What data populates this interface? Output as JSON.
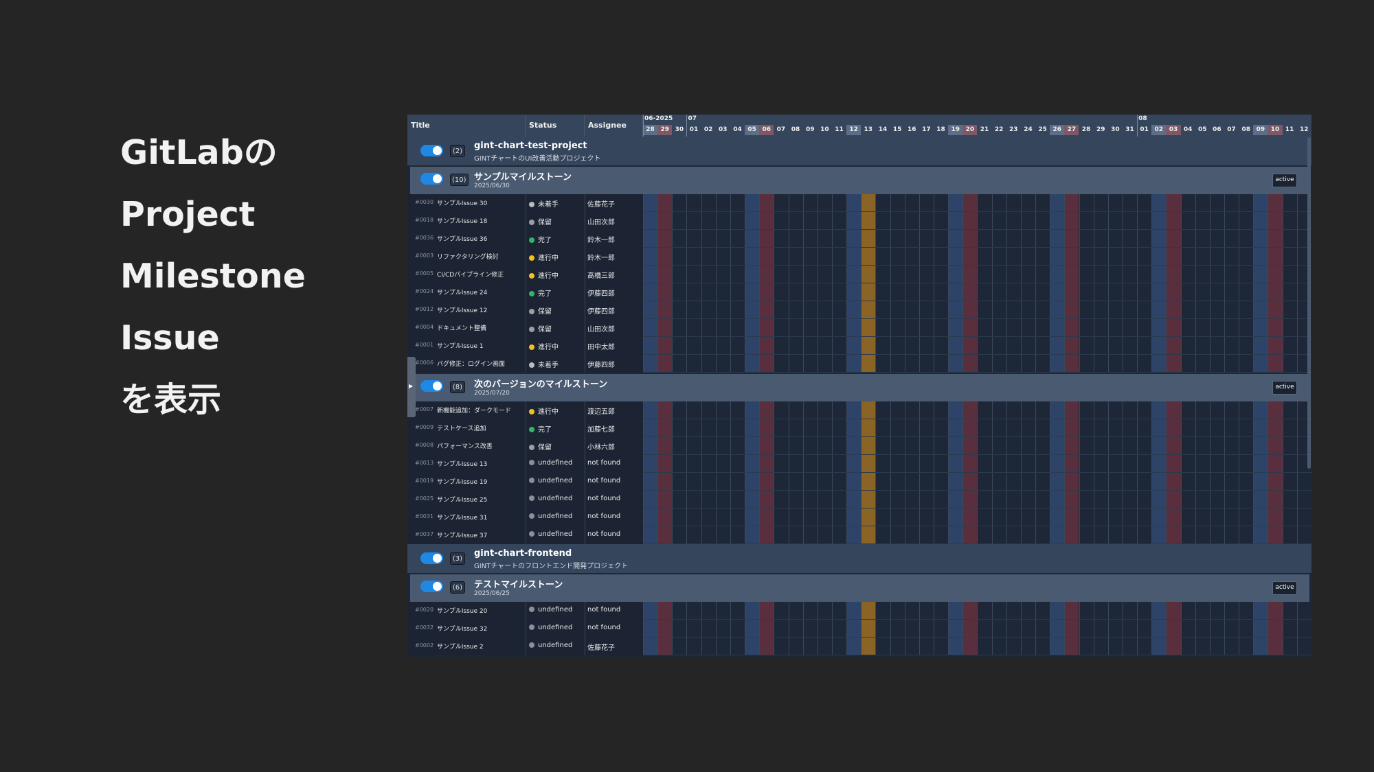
{
  "slide_lines": [
    "GitLabの",
    "Project",
    "Milestone",
    "Issue",
    "を表示"
  ],
  "columns": {
    "title": "Title",
    "status": "Status",
    "assignee": "Assignee"
  },
  "months": [
    {
      "label": "06-2025",
      "day_index": 0
    },
    {
      "label": "07",
      "day_index": 3
    },
    {
      "label": "08",
      "day_index": 34
    }
  ],
  "days": [
    {
      "d": "28",
      "w": "sat"
    },
    {
      "d": "29",
      "w": "sun"
    },
    {
      "d": "30",
      "w": ""
    },
    {
      "d": "01",
      "w": ""
    },
    {
      "d": "02",
      "w": ""
    },
    {
      "d": "03",
      "w": ""
    },
    {
      "d": "04",
      "w": ""
    },
    {
      "d": "05",
      "w": "sat"
    },
    {
      "d": "06",
      "w": "sun"
    },
    {
      "d": "07",
      "w": ""
    },
    {
      "d": "08",
      "w": ""
    },
    {
      "d": "09",
      "w": ""
    },
    {
      "d": "10",
      "w": ""
    },
    {
      "d": "11",
      "w": ""
    },
    {
      "d": "12",
      "w": "sat"
    },
    {
      "d": "13",
      "w": "today"
    },
    {
      "d": "14",
      "w": ""
    },
    {
      "d": "15",
      "w": ""
    },
    {
      "d": "16",
      "w": ""
    },
    {
      "d": "17",
      "w": ""
    },
    {
      "d": "18",
      "w": ""
    },
    {
      "d": "19",
      "w": "sat"
    },
    {
      "d": "20",
      "w": "sun"
    },
    {
      "d": "21",
      "w": ""
    },
    {
      "d": "22",
      "w": ""
    },
    {
      "d": "23",
      "w": ""
    },
    {
      "d": "24",
      "w": ""
    },
    {
      "d": "25",
      "w": ""
    },
    {
      "d": "26",
      "w": "sat"
    },
    {
      "d": "27",
      "w": "sun"
    },
    {
      "d": "28",
      "w": ""
    },
    {
      "d": "29",
      "w": ""
    },
    {
      "d": "30",
      "w": ""
    },
    {
      "d": "31",
      "w": ""
    },
    {
      "d": "01",
      "w": ""
    },
    {
      "d": "02",
      "w": "sat"
    },
    {
      "d": "03",
      "w": "sun"
    },
    {
      "d": "04",
      "w": ""
    },
    {
      "d": "05",
      "w": ""
    },
    {
      "d": "06",
      "w": ""
    },
    {
      "d": "07",
      "w": ""
    },
    {
      "d": "08",
      "w": ""
    },
    {
      "d": "09",
      "w": "sat"
    },
    {
      "d": "10",
      "w": "sun"
    },
    {
      "d": "11",
      "w": ""
    },
    {
      "d": "12",
      "w": ""
    }
  ],
  "status_colors": {
    "未着手": "#b8bcc4",
    "保留": "#9aa0aa",
    "完了": "#2fb765",
    "進行中": "#f2c11c",
    "undefined": "#8a8f98"
  },
  "rows": [
    {
      "type": "project",
      "count": "(2)",
      "title": "gint-chart-test-project",
      "subtitle": "GINTチャートのUI改善活動プロジェクト"
    },
    {
      "type": "milestone",
      "count": "(10)",
      "title": "サンプルマイルストーン",
      "subtitle": "2025/06/30",
      "badge": "active"
    },
    {
      "type": "issue",
      "num": "#0030",
      "title": "サンプルIssue 30",
      "status": "未着手",
      "assignee": "佐藤花子"
    },
    {
      "type": "issue",
      "num": "#0018",
      "title": "サンプルIssue 18",
      "status": "保留",
      "assignee": "山田次郎"
    },
    {
      "type": "issue",
      "num": "#0036",
      "title": "サンプルIssue 36",
      "status": "完了",
      "assignee": "鈴木一郎"
    },
    {
      "type": "issue",
      "num": "#0003",
      "title": "リファクタリング検討",
      "status": "進行中",
      "assignee": "鈴木一郎"
    },
    {
      "type": "issue",
      "num": "#0005",
      "title": "CI/CDパイプライン修正",
      "status": "進行中",
      "assignee": "高橋三郎"
    },
    {
      "type": "issue",
      "num": "#0024",
      "title": "サンプルIssue 24",
      "status": "完了",
      "assignee": "伊藤四郎"
    },
    {
      "type": "issue",
      "num": "#0012",
      "title": "サンプルIssue 12",
      "status": "保留",
      "assignee": "伊藤四郎"
    },
    {
      "type": "issue",
      "num": "#0004",
      "title": "ドキュメント整備",
      "status": "保留",
      "assignee": "山田次郎"
    },
    {
      "type": "issue",
      "num": "#0001",
      "title": "サンプルIssue 1",
      "status": "進行中",
      "assignee": "田中太郎"
    },
    {
      "type": "issue",
      "num": "#0006",
      "title": "バグ修正：ログイン画面",
      "status": "未着手",
      "assignee": "伊藤四郎"
    },
    {
      "type": "milestone",
      "count": "(8)",
      "title": "次のバージョンのマイルストーン",
      "subtitle": "2025/07/20",
      "badge": "active"
    },
    {
      "type": "issue",
      "num": "#0007",
      "title": "新機能追加：ダークモード",
      "status": "進行中",
      "assignee": "渡辺五郎"
    },
    {
      "type": "issue",
      "num": "#0009",
      "title": "テストケース追加",
      "status": "完了",
      "assignee": "加藤七郎"
    },
    {
      "type": "issue",
      "num": "#0008",
      "title": "パフォーマンス改善",
      "status": "保留",
      "assignee": "小林六郎"
    },
    {
      "type": "issue",
      "num": "#0013",
      "title": "サンプルIssue 13",
      "status": "undefined",
      "assignee": "not found"
    },
    {
      "type": "issue",
      "num": "#0019",
      "title": "サンプルIssue 19",
      "status": "undefined",
      "assignee": "not found"
    },
    {
      "type": "issue",
      "num": "#0025",
      "title": "サンプルIssue 25",
      "status": "undefined",
      "assignee": "not found"
    },
    {
      "type": "issue",
      "num": "#0031",
      "title": "サンプルIssue 31",
      "status": "undefined",
      "assignee": "not found"
    },
    {
      "type": "issue",
      "num": "#0037",
      "title": "サンプルIssue 37",
      "status": "undefined",
      "assignee": "not found"
    },
    {
      "type": "project",
      "count": "(3)",
      "title": "gint-chart-frontend",
      "subtitle": "GINTチャートのフロントエンド開発プロジェクト"
    },
    {
      "type": "milestone",
      "count": "(6)",
      "title": "テストマイルストーン",
      "subtitle": "2025/06/25",
      "badge": "active"
    },
    {
      "type": "issue",
      "num": "#0020",
      "title": "サンプルIssue 20",
      "status": "undefined",
      "assignee": "not found"
    },
    {
      "type": "issue",
      "num": "#0032",
      "title": "サンプルIssue 32",
      "status": "undefined",
      "assignee": "not found"
    },
    {
      "type": "issue",
      "num": "#0002",
      "title": "サンプルIssue 2",
      "status": "undefined",
      "assignee": "佐藤花子"
    }
  ]
}
